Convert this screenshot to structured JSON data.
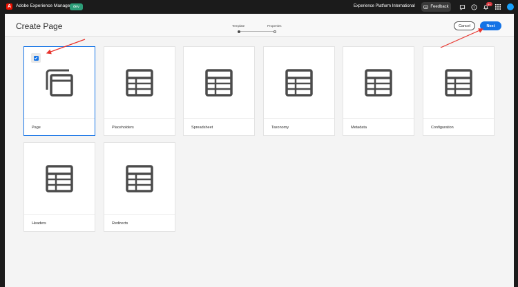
{
  "topbar": {
    "app_title": "Adobe Experience Manager",
    "env_badge": "dev",
    "org_name": "Experience Platform International",
    "feedback_label": "Feedback",
    "notification_count": "9+"
  },
  "header": {
    "title": "Create Page",
    "steps": [
      {
        "label": "Template",
        "active": true
      },
      {
        "label": "Properties",
        "active": false
      }
    ],
    "cancel_label": "Cancel",
    "next_label": "Next"
  },
  "templates": [
    {
      "label": "Page",
      "icon": "page-stack-icon",
      "selected": true
    },
    {
      "label": "Placeholders",
      "icon": "table-icon",
      "selected": false
    },
    {
      "label": "Spreadsheet",
      "icon": "table-icon",
      "selected": false
    },
    {
      "label": "Taxonomy",
      "icon": "table-icon",
      "selected": false
    },
    {
      "label": "Metadata",
      "icon": "table-icon",
      "selected": false
    },
    {
      "label": "Configuration",
      "icon": "table-icon",
      "selected": false
    },
    {
      "label": "Headers",
      "icon": "table-icon",
      "selected": false
    },
    {
      "label": "Redirects",
      "icon": "table-icon",
      "selected": false
    }
  ],
  "colors": {
    "accent": "#1473e6",
    "annotation_arrow": "#e8332c",
    "adobe_red": "#eb1000",
    "env_badge": "#2d9d78"
  }
}
